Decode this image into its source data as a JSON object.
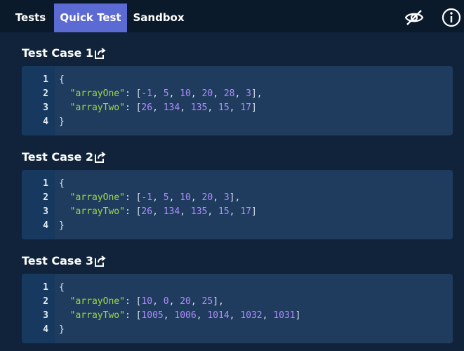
{
  "tabs": [
    {
      "label": "Tests"
    },
    {
      "label": "Quick Test"
    },
    {
      "label": "Sandbox"
    }
  ],
  "icons": {
    "hide": "eye-off-icon",
    "info": "info-icon",
    "share": "share-icon"
  },
  "colors": {
    "active_tab": "#5b6bd3",
    "key": "#9fd74a",
    "number": "#b08cff"
  },
  "test_cases": [
    {
      "title": "Test Case 1",
      "keys": [
        "\"arrayOne\"",
        "\"arrayTwo\""
      ],
      "arrays": [
        [
          "-1",
          "5",
          "10",
          "20",
          "28",
          "3"
        ],
        [
          "26",
          "134",
          "135",
          "15",
          "17"
        ]
      ]
    },
    {
      "title": "Test Case 2",
      "keys": [
        "\"arrayOne\"",
        "\"arrayTwo\""
      ],
      "arrays": [
        [
          "-1",
          "5",
          "10",
          "20",
          "3"
        ],
        [
          "26",
          "134",
          "135",
          "15",
          "17"
        ]
      ]
    },
    {
      "title": "Test Case 3",
      "keys": [
        "\"arrayOne\"",
        "\"arrayTwo\""
      ],
      "arrays": [
        [
          "10",
          "0",
          "20",
          "25"
        ],
        [
          "1005",
          "1006",
          "1014",
          "1032",
          "1031"
        ]
      ]
    }
  ],
  "line_numbers": [
    "1",
    "2",
    "3",
    "4"
  ],
  "syntax": {
    "open_brace": "{",
    "close_brace": "}"
  }
}
